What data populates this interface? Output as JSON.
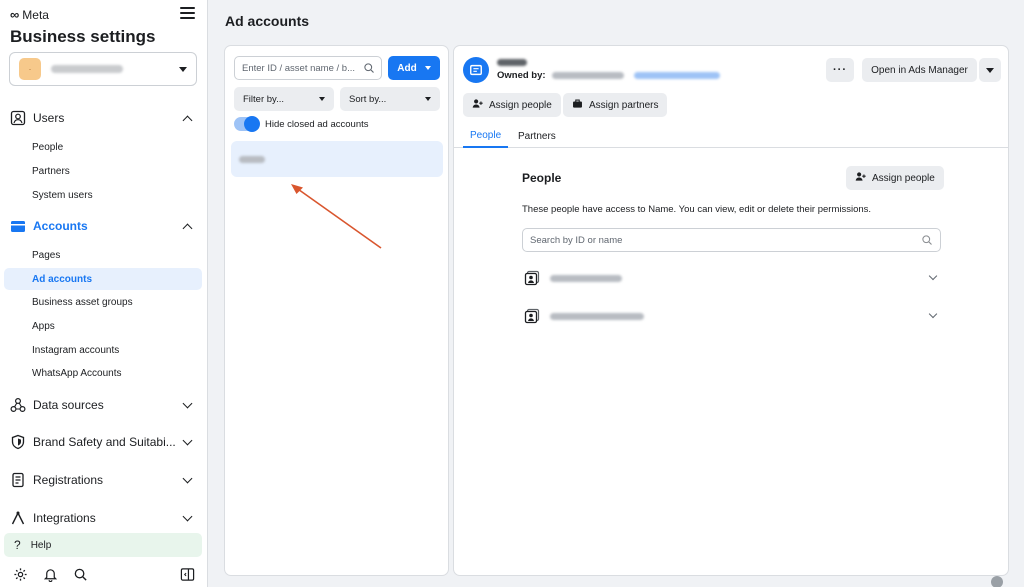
{
  "sidebar": {
    "brand": "Meta",
    "title": "Business settings",
    "sections": {
      "users": "Users",
      "accounts": "Accounts",
      "data_sources": "Data sources",
      "brand_safety": "Brand Safety and Suitabi...",
      "registrations": "Registrations",
      "integrations": "Integrations"
    },
    "users_items": [
      "People",
      "Partners",
      "System users"
    ],
    "accounts_items": [
      "Pages",
      "Ad accounts",
      "Business asset groups",
      "Apps",
      "Instagram accounts",
      "WhatsApp Accounts"
    ],
    "help": "Help"
  },
  "page": {
    "title": "Ad accounts"
  },
  "list_panel": {
    "search_placeholder": "Enter ID / asset name / b...",
    "add_label": "Add",
    "filter_label": "Filter by...",
    "sort_label": "Sort by...",
    "hide_closed_label": "Hide closed ad accounts"
  },
  "detail": {
    "owned_by_label": "Owned by:",
    "more_label": "···",
    "open_ads_manager": "Open in Ads Manager",
    "assign_people": "Assign people",
    "assign_partners": "Assign partners",
    "tabs": [
      "People",
      "Partners"
    ],
    "people_title": "People",
    "people_desc": "These people have access to Name. You can view, edit or delete their permissions.",
    "people_search_placeholder": "Search by ID or name"
  },
  "colors": {
    "accent": "#1877f2",
    "active_bg": "#e7f0fd",
    "help_bg": "#e8f5ec",
    "arrow": "#d9562e"
  },
  "icons": [
    "meta-logo-icon",
    "hamburger-icon",
    "users-icon",
    "accounts-icon",
    "data-sources-icon",
    "shield-icon",
    "registrations-icon",
    "integrations-icon",
    "help-icon",
    "gear-icon",
    "bell-icon",
    "search-icon",
    "panel-toggle-icon",
    "person-add-icon",
    "briefcase-icon",
    "person-badge-icon",
    "chevron-down-icon"
  ]
}
